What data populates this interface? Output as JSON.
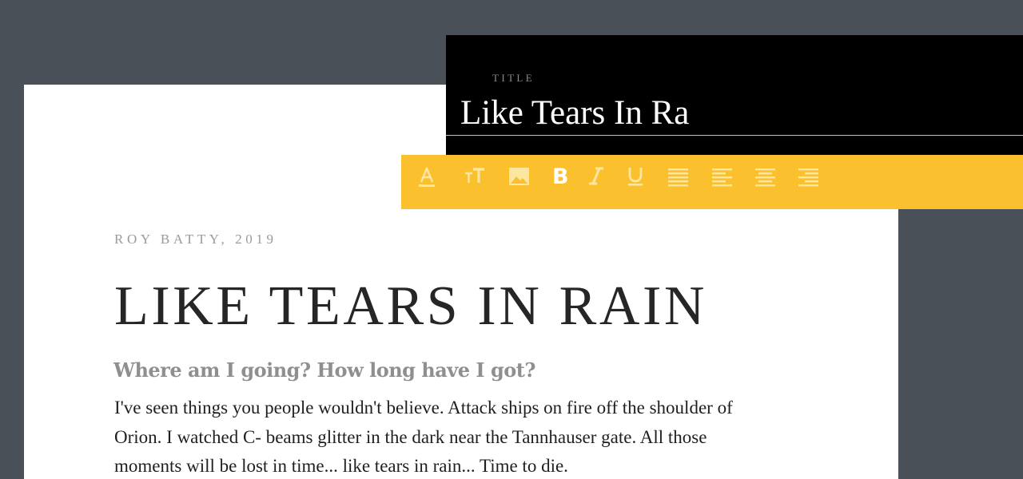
{
  "article": {
    "byline": "ROY BATTY, 2019",
    "headline": "LIKE TEARS IN RAIN",
    "subhead": "Where am I going? How long have I got?",
    "body": "I've seen things you people wouldn't believe. Attack ships on fire off the shoulder of Orion. I watched C- beams glitter in the dark near the Tannhauser gate. All those moments will be lost in time... like tears in rain... Time to die."
  },
  "title_editor": {
    "label": "TITLE",
    "value": "Like Tears In Ra"
  },
  "toolbar": {
    "tools": [
      {
        "name": "text-color",
        "icon": "text-color-icon"
      },
      {
        "name": "font-size",
        "icon": "font-size-icon"
      },
      {
        "name": "image",
        "icon": "image-icon"
      },
      {
        "name": "bold",
        "icon": "bold-icon",
        "active": true
      },
      {
        "name": "italic",
        "icon": "italic-icon"
      },
      {
        "name": "underline",
        "icon": "underline-icon"
      },
      {
        "name": "justify",
        "icon": "align-justify-icon"
      },
      {
        "name": "align-left",
        "icon": "align-left-icon"
      },
      {
        "name": "align-center",
        "icon": "align-center-icon"
      },
      {
        "name": "align-right",
        "icon": "align-right-icon"
      }
    ]
  },
  "colors": {
    "background": "#495057",
    "paper": "#ffffff",
    "title_panel": "#000000",
    "toolbar": "#fbc02d",
    "toolbar_icon": "#fde6a2",
    "toolbar_icon_active": "#ffffff"
  }
}
